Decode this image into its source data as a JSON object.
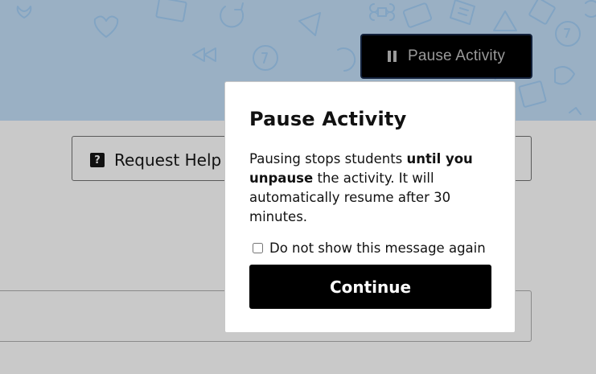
{
  "header": {
    "pause_button_label": "Pause Activity",
    "background_color": "#9ab0c4"
  },
  "main": {
    "help_button_label": "Request Help",
    "help_icon_glyph": "?"
  },
  "modal": {
    "title": "Pause Activity",
    "text_part1": "Pausing stops students ",
    "text_bold": "until you unpause",
    "text_part2": " the activity. It will automatically resume after 30 minutes.",
    "checkbox_label": "Do not show this message again",
    "checkbox_checked": false,
    "continue_label": "Continue"
  },
  "icons": {
    "pause": "pause-icon",
    "help": "question-mark-icon"
  }
}
